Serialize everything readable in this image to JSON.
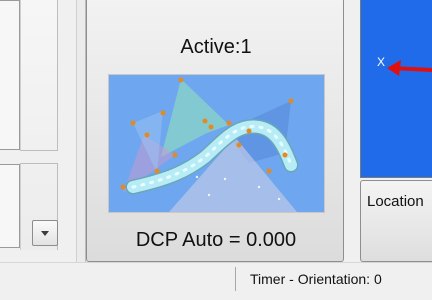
{
  "dcp_panel": {
    "active_label": "Active:1",
    "value_label": "DCP Auto = 0.000"
  },
  "viewport": {
    "axis_label": "X"
  },
  "location_button": {
    "label": "Location"
  },
  "status_bar": {
    "timer_text": "Timer - Orientation: 0"
  },
  "colors": {
    "thumbnail_sky": "#6ea6ef",
    "viewport_blue": "#1f6bea",
    "axis_arrow": "#e01010",
    "tube": "#b6ecf6",
    "control_point": "#e58a1d"
  },
  "icons": {
    "scroll_down": "chevron-down-icon",
    "axis": "red-arrow-icon"
  }
}
